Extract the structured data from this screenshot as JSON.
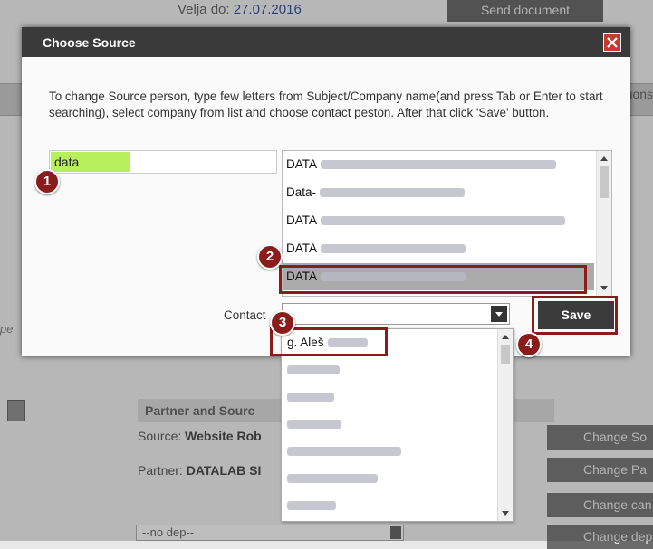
{
  "background": {
    "valid_label": "Velja do:",
    "valid_date": "27.07.2016",
    "send_button": "Send document",
    "header_right": "ions",
    "left_fragment": "pe",
    "partner_section_title": "Partner and Sourc",
    "source_label": "Source:",
    "source_value": "Website Rob",
    "partner_label": "Partner:",
    "partner_value": "DATALAB SI",
    "buttons": [
      "Change So",
      "Change Pa",
      "Change can",
      "Change depa"
    ],
    "department_select": "--no dep--"
  },
  "dialog": {
    "title": "Choose Source",
    "instructions": "To change Source person, type few letters from Subject/Company name(and press Tab or Enter to start searching), select company from list and choose contact peston. After that click 'Save' button.",
    "search_value": "data",
    "companies": [
      {
        "label": "DATA"
      },
      {
        "label": "Data-"
      },
      {
        "label": "DATA"
      },
      {
        "label": "DATA"
      },
      {
        "label": "DATA"
      }
    ],
    "contact_label": "Contact",
    "contact_value": "",
    "save_label": "Save",
    "contacts": [
      {
        "label": "g. Aleš"
      },
      {
        "label": ""
      },
      {
        "label": ""
      },
      {
        "label": ""
      },
      {
        "label": ""
      },
      {
        "label": ""
      },
      {
        "label": ""
      }
    ]
  },
  "callouts": [
    "1",
    "2",
    "3",
    "4"
  ],
  "colors": {
    "accent_dark": "#3a3a3a",
    "callout": "#8b1c1c",
    "search_highlight": "#b6f05a",
    "close": "#c93a2e"
  }
}
